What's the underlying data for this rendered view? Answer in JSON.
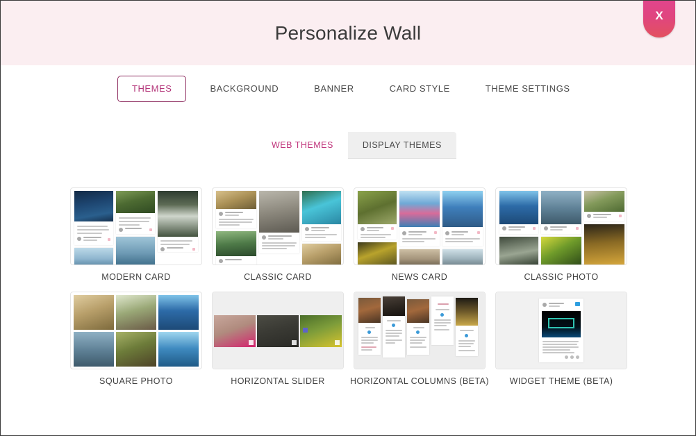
{
  "dialog": {
    "title": "Personalize Wall",
    "close_label": "X",
    "accent_color": "#c0357c",
    "header_bg": "#fbeef1",
    "close_color": "#e0458c"
  },
  "main_tabs": [
    {
      "label": "THEMES",
      "active": true
    },
    {
      "label": "BACKGROUND",
      "active": false
    },
    {
      "label": "BANNER",
      "active": false
    },
    {
      "label": "CARD STYLE",
      "active": false
    },
    {
      "label": "THEME SETTINGS",
      "active": false
    }
  ],
  "sub_tabs": [
    {
      "label": "WEB THEMES",
      "active": true
    },
    {
      "label": "DISPLAY THEMES",
      "active": false
    }
  ],
  "themes": [
    {
      "label": "MODERN CARD",
      "style": "modern-card"
    },
    {
      "label": "CLASSIC CARD",
      "style": "classic-card"
    },
    {
      "label": "NEWS CARD",
      "style": "news-card"
    },
    {
      "label": "CLASSIC PHOTO",
      "style": "classic-photo"
    },
    {
      "label": "SQUARE PHOTO",
      "style": "square-photo"
    },
    {
      "label": "HORIZONTAL SLIDER",
      "style": "horizontal-slider"
    },
    {
      "label": "HORIZONTAL COLUMNS (BETA)",
      "style": "horizontal-columns"
    },
    {
      "label": "WIDGET THEME (BETA)",
      "style": "widget-theme"
    }
  ]
}
